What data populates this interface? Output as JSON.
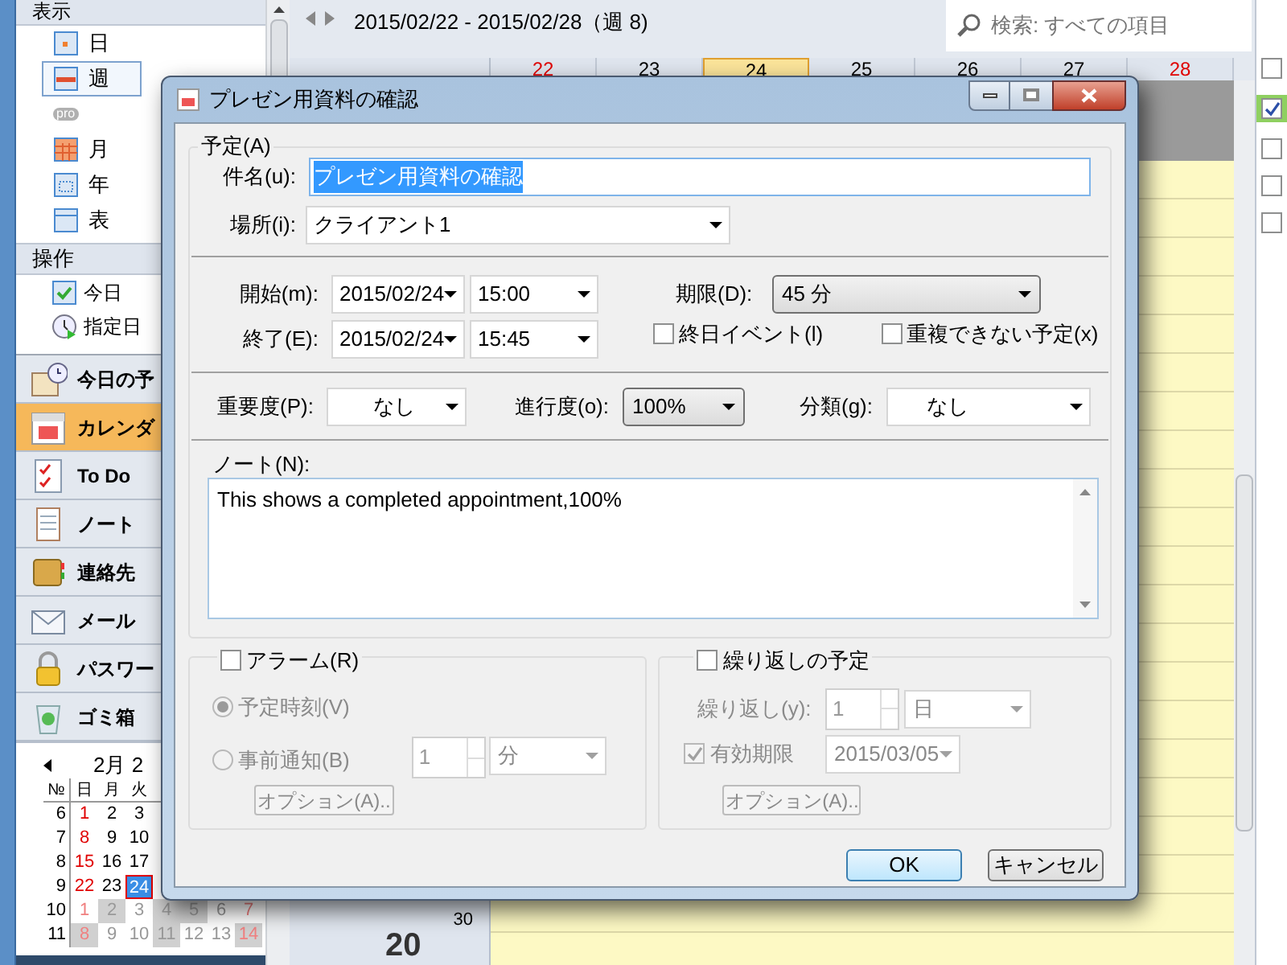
{
  "sidebar": {
    "view_header": "表示",
    "view_items": [
      {
        "label": "日",
        "kind": "day",
        "selected": false
      },
      {
        "label": "週",
        "kind": "week",
        "selected": true
      },
      {
        "label": "pro",
        "kind": "badge",
        "selected": false
      },
      {
        "label": "月",
        "kind": "month",
        "selected": false
      },
      {
        "label": "年",
        "kind": "year",
        "selected": false
      },
      {
        "label": "表",
        "kind": "table",
        "selected": false
      }
    ],
    "action_header": "操作",
    "action_items": [
      {
        "label": "今日",
        "kind": "today"
      },
      {
        "label": "指定日",
        "kind": "goto"
      }
    ],
    "nav": [
      {
        "label": "今日の予",
        "kind": "agenda",
        "selected": false
      },
      {
        "label": "カレンダ",
        "kind": "calendar",
        "selected": true
      },
      {
        "label": "To Do",
        "kind": "todo",
        "selected": false
      },
      {
        "label": "ノート",
        "kind": "note",
        "selected": false
      },
      {
        "label": "連絡先",
        "kind": "contacts",
        "selected": false
      },
      {
        "label": "メール",
        "kind": "mail",
        "selected": false
      },
      {
        "label": "パスワー",
        "kind": "password",
        "selected": false
      },
      {
        "label": "ゴミ箱",
        "kind": "trash",
        "selected": false
      }
    ]
  },
  "mini_calendar": {
    "month": "2月 2",
    "columns": [
      "№",
      "日",
      "月",
      "火"
    ],
    "weeks": [
      {
        "week": "6",
        "days": [
          {
            "d": "1",
            "kind": "sunday"
          },
          {
            "d": "2",
            "kind": "day"
          },
          {
            "d": "3",
            "kind": "day"
          }
        ]
      },
      {
        "week": "7",
        "days": [
          {
            "d": "8",
            "kind": "sunday"
          },
          {
            "d": "9",
            "kind": "day"
          },
          {
            "d": "10",
            "kind": "day"
          }
        ]
      },
      {
        "week": "8",
        "days": [
          {
            "d": "15",
            "kind": "sunday"
          },
          {
            "d": "16",
            "kind": "day"
          },
          {
            "d": "17",
            "kind": "day"
          }
        ]
      },
      {
        "week": "9",
        "days": [
          {
            "d": "22",
            "kind": "sunday"
          },
          {
            "d": "23",
            "kind": "day"
          },
          {
            "d": "24",
            "kind": "today"
          }
        ]
      },
      {
        "week": "10",
        "days": [
          {
            "d": "1",
            "kind": "other-sunday"
          },
          {
            "d": "2",
            "kind": "other-shaded"
          },
          {
            "d": "3",
            "kind": "other"
          },
          {
            "d": "4",
            "kind": "other-shaded"
          },
          {
            "d": "5",
            "kind": "other-shaded"
          },
          {
            "d": "6",
            "kind": "other"
          },
          {
            "d": "7",
            "kind": "other-sunday"
          }
        ]
      },
      {
        "week": "11",
        "days": [
          {
            "d": "8",
            "kind": "other-sunday-shaded"
          },
          {
            "d": "9",
            "kind": "other"
          },
          {
            "d": "10",
            "kind": "other"
          },
          {
            "d": "11",
            "kind": "other-shaded"
          },
          {
            "d": "12",
            "kind": "other"
          },
          {
            "d": "13",
            "kind": "other"
          },
          {
            "d": "14",
            "kind": "other-sunday-shaded"
          }
        ]
      }
    ]
  },
  "calendar": {
    "range": "2015/02/22 - 2015/02/28（週 8)",
    "search": {
      "placeholder": "検索: すべての項目"
    },
    "day_headers": [
      {
        "label": "22",
        "kind": "weekend"
      },
      {
        "label": "23",
        "kind": "weekday"
      },
      {
        "label": "24",
        "kind": "today"
      },
      {
        "label": "25",
        "kind": "weekday"
      },
      {
        "label": "26",
        "kind": "weekday"
      },
      {
        "label": "27",
        "kind": "weekday"
      },
      {
        "label": "28",
        "kind": "weekend"
      }
    ],
    "time_labels": [
      {
        "label": "30",
        "kind": "minute"
      },
      {
        "label": "20",
        "kind": "hour"
      }
    ]
  },
  "right_panel": {
    "checkboxes": [
      {
        "checked": false
      },
      {
        "checked": true
      },
      {
        "checked": false
      },
      {
        "checked": false
      },
      {
        "checked": false
      }
    ]
  },
  "dialog": {
    "title": "プレゼン用資料の確認",
    "group_label": "予定(A)",
    "subject": {
      "label": "件名(u):",
      "value": "プレゼン用資料の確認"
    },
    "location": {
      "label": "場所(i):",
      "value": "クライアント1"
    },
    "start": {
      "label": "開始(m):",
      "date": "2015/02/24",
      "time": "15:00"
    },
    "end": {
      "label": "終了(E):",
      "date": "2015/02/24",
      "time": "15:45"
    },
    "duration": {
      "label": "期限(D):",
      "value": "45 分"
    },
    "all_day": {
      "label": "終日イベント(l)",
      "checked": false
    },
    "no_overlap": {
      "label": "重複できない予定(x)",
      "checked": false
    },
    "priority": {
      "label": "重要度(P):",
      "value": "なし"
    },
    "progress": {
      "label": "進行度(o):",
      "value": "100%"
    },
    "category": {
      "label": "分類(g):",
      "value": "なし"
    },
    "note": {
      "label": "ノート(N):",
      "value": "This shows a completed appointment,100%"
    },
    "alarm": {
      "label": "アラーム(R)",
      "checked": false,
      "options": [
        {
          "label": "予定時刻(V)",
          "selected": true
        },
        {
          "label": "事前通知(B)",
          "selected": false
        }
      ],
      "amount": "1",
      "unit": "分",
      "button": "オプション(A).."
    },
    "recurrence": {
      "label": "繰り返しの予定",
      "checked": false,
      "interval_label": "繰り返し(y):",
      "interval": "1",
      "unit": "日",
      "expiry": {
        "label": "有効期限",
        "checked": true,
        "date": "2015/03/05"
      },
      "button": "オプション(A).."
    },
    "buttons": [
      {
        "label": "OK",
        "kind": "default"
      },
      {
        "label": "キャンセル",
        "kind": "normal"
      }
    ]
  }
}
